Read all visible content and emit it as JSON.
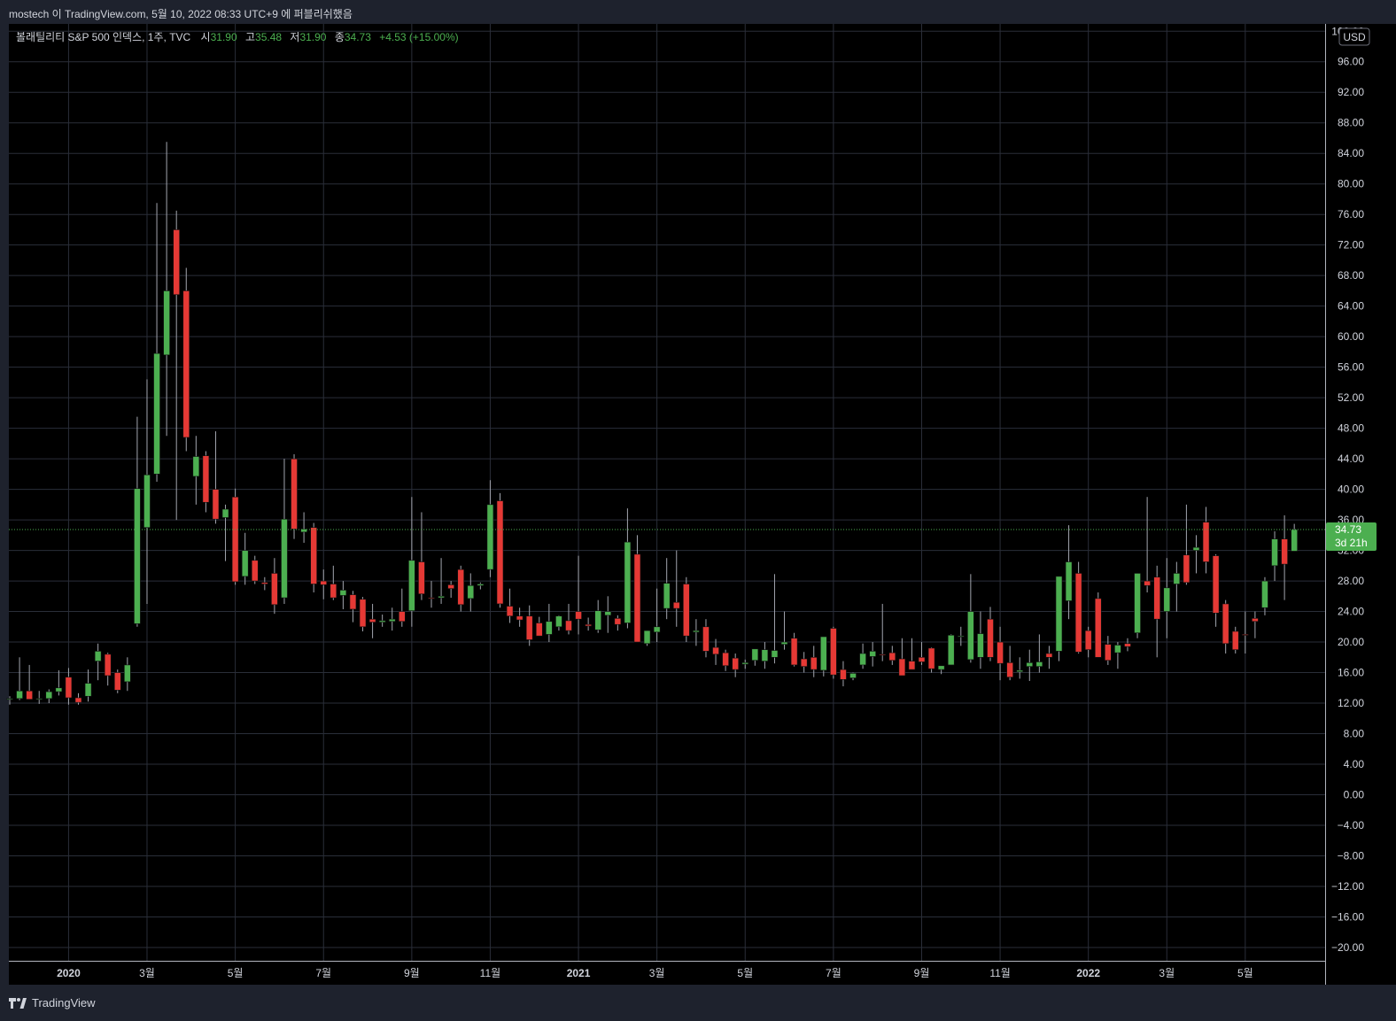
{
  "attribution": "mostech 이 TradingView.com, 5월 10, 2022 08:33 UTC+9 에 퍼블리쉬했음",
  "brand": "TradingView",
  "currency": "USD",
  "colors": {
    "up": "#4caf50",
    "down": "#e53935",
    "background": "#000000",
    "grid": "#2a2e39",
    "text": "#d1d4dc",
    "price_line": "#4caf50"
  },
  "legend": {
    "symbol": "볼래틸리티 S&P 500 인덱스, 1주, TVC",
    "o_label": "시",
    "o_value": "31.90",
    "h_label": "고",
    "h_value": "35.48",
    "l_label": "저",
    "l_value": "31.90",
    "c_label": "종",
    "c_value": "34.73",
    "change": "+4.53 (+15.00%)"
  },
  "last_price": {
    "value": "34.73",
    "countdown": "3d 21h"
  },
  "chart_data": {
    "type": "candlestick",
    "interval": "1주",
    "ylim": [
      -22,
      100
    ],
    "y_ticks": [
      -20,
      -16,
      -12,
      -8,
      -4,
      0,
      4,
      8,
      12,
      16,
      20,
      24,
      28,
      32,
      36,
      40,
      44,
      48,
      52,
      56,
      60,
      64,
      68,
      72,
      76,
      80,
      84,
      88,
      92,
      96,
      100
    ],
    "y_tick_labels": [
      "−20.00",
      "−16.00",
      "−12.00",
      "−8.00",
      "−4.00",
      "0.00",
      "4.00",
      "8.00",
      "12.00",
      "16.00",
      "20.00",
      "24.00",
      "28.00",
      "32.00",
      "36.00",
      "40.00",
      "44.00",
      "48.00",
      "52.00",
      "56.00",
      "60.00",
      "64.00",
      "68.00",
      "72.00",
      "76.00",
      "80.00",
      "84.00",
      "88.00",
      "92.00",
      "96.00",
      "100.00"
    ],
    "x_ticks": [
      {
        "label": "2020",
        "bold": true,
        "index": 6
      },
      {
        "label": "3월",
        "bold": false,
        "index": 14
      },
      {
        "label": "5월",
        "bold": false,
        "index": 23
      },
      {
        "label": "7월",
        "bold": false,
        "index": 32
      },
      {
        "label": "9월",
        "bold": false,
        "index": 41
      },
      {
        "label": "11월",
        "bold": false,
        "index": 49
      },
      {
        "label": "2021",
        "bold": true,
        "index": 58
      },
      {
        "label": "3월",
        "bold": false,
        "index": 66
      },
      {
        "label": "5월",
        "bold": false,
        "index": 75
      },
      {
        "label": "7월",
        "bold": false,
        "index": 84
      },
      {
        "label": "9월",
        "bold": false,
        "index": 93
      },
      {
        "label": "11월",
        "bold": false,
        "index": 101
      },
      {
        "label": "2022",
        "bold": true,
        "index": 110
      },
      {
        "label": "3월",
        "bold": false,
        "index": 118
      },
      {
        "label": "5월",
        "bold": false,
        "index": 126
      }
    ],
    "ohlc": [
      [
        12.5,
        12.9,
        11.8,
        12.6
      ],
      [
        12.6,
        18.0,
        12.4,
        13.6
      ],
      [
        13.6,
        17.0,
        12.5,
        12.5
      ],
      [
        12.5,
        13.6,
        11.9,
        12.6
      ],
      [
        12.6,
        13.8,
        12.0,
        13.5
      ],
      [
        13.5,
        16.3,
        13.0,
        14.0
      ],
      [
        15.4,
        16.6,
        11.8,
        12.7
      ],
      [
        12.7,
        13.3,
        11.8,
        12.1
      ],
      [
        12.9,
        16.4,
        12.2,
        14.6
      ],
      [
        17.5,
        19.8,
        15.0,
        18.8
      ],
      [
        18.4,
        18.6,
        14.3,
        15.6
      ],
      [
        16.0,
        16.4,
        13.3,
        13.7
      ],
      [
        14.8,
        18.0,
        13.6,
        17.0
      ],
      [
        22.4,
        49.5,
        22.0,
        40.1
      ],
      [
        35.0,
        54.4,
        25.0,
        41.9
      ],
      [
        42.0,
        77.5,
        41.0,
        57.8
      ],
      [
        57.6,
        85.5,
        47.0,
        66.0
      ],
      [
        74.0,
        76.5,
        36.0,
        65.5
      ],
      [
        66.0,
        69.0,
        45.0,
        46.8
      ],
      [
        41.7,
        47.0,
        38.0,
        44.3
      ],
      [
        44.4,
        45.0,
        37.0,
        38.3
      ],
      [
        40.0,
        47.6,
        35.5,
        36.1
      ],
      [
        36.3,
        38.0,
        30.6,
        37.4
      ],
      [
        39.0,
        40.1,
        27.5,
        27.9
      ],
      [
        28.6,
        34.3,
        27.5,
        32.0
      ],
      [
        30.7,
        31.3,
        27.6,
        28.0
      ],
      [
        27.8,
        28.5,
        26.8,
        27.6
      ],
      [
        29.0,
        31.0,
        23.7,
        24.9
      ],
      [
        25.8,
        44.0,
        25.0,
        36.1
      ],
      [
        44.0,
        44.6,
        33.5,
        34.8
      ],
      [
        34.4,
        37.0,
        33.0,
        34.8
      ],
      [
        35.0,
        35.6,
        26.5,
        27.6
      ],
      [
        28.0,
        29.5,
        25.6,
        27.5
      ],
      [
        27.6,
        30.0,
        25.5,
        25.8
      ],
      [
        26.1,
        28.0,
        24.3,
        26.8
      ],
      [
        26.2,
        26.7,
        22.6,
        24.3
      ],
      [
        25.6,
        25.9,
        21.4,
        22.0
      ],
      [
        23.0,
        25.0,
        20.5,
        22.6
      ],
      [
        22.6,
        23.6,
        22.0,
        22.8
      ],
      [
        22.7,
        24.5,
        21.5,
        23.0
      ],
      [
        24.0,
        27.0,
        22.0,
        22.7
      ],
      [
        24.1,
        39.0,
        22.0,
        30.7
      ],
      [
        30.5,
        37.0,
        25.5,
        26.3
      ],
      [
        25.8,
        28.0,
        24.5,
        25.7
      ],
      [
        25.8,
        31.0,
        25.0,
        26.0
      ],
      [
        27.5,
        28.0,
        25.8,
        27.0
      ],
      [
        29.5,
        30.0,
        24.0,
        24.9
      ],
      [
        25.7,
        29.0,
        24.0,
        27.4
      ],
      [
        27.4,
        27.8,
        26.9,
        27.6
      ],
      [
        29.5,
        41.2,
        28.5,
        38.0
      ],
      [
        38.5,
        39.5,
        24.5,
        25.0
      ],
      [
        24.7,
        27.0,
        22.5,
        23.4
      ],
      [
        23.4,
        24.5,
        22.0,
        22.9
      ],
      [
        23.4,
        24.8,
        19.5,
        20.3
      ],
      [
        22.5,
        23.3,
        20.8,
        20.8
      ],
      [
        21.0,
        25.0,
        20.0,
        22.7
      ],
      [
        22.0,
        23.5,
        21.5,
        23.4
      ],
      [
        22.8,
        25.0,
        21.0,
        21.5
      ],
      [
        24.0,
        31.3,
        21.0,
        23.0
      ],
      [
        22.3,
        23.2,
        21.5,
        22.1
      ],
      [
        21.6,
        25.5,
        21.2,
        24.1
      ],
      [
        23.5,
        26.0,
        21.2,
        24.0
      ],
      [
        23.1,
        23.5,
        21.5,
        22.3
      ],
      [
        22.5,
        37.5,
        21.8,
        33.1
      ],
      [
        31.5,
        34.0,
        20.5,
        20.0
      ],
      [
        19.8,
        21.5,
        19.5,
        21.5
      ],
      [
        21.3,
        27.0,
        20.0,
        22.0
      ],
      [
        24.4,
        31.0,
        23.0,
        27.7
      ],
      [
        25.2,
        32.0,
        22.0,
        24.4
      ],
      [
        27.6,
        28.5,
        20.0,
        20.8
      ],
      [
        21.3,
        23.0,
        19.5,
        21.5
      ],
      [
        22.0,
        23.0,
        18.0,
        18.8
      ],
      [
        19.3,
        20.4,
        17.0,
        18.4
      ],
      [
        18.6,
        19.0,
        16.2,
        16.9
      ],
      [
        17.9,
        18.5,
        15.4,
        16.4
      ],
      [
        17.1,
        17.7,
        16.5,
        17.3
      ],
      [
        17.6,
        19.0,
        16.9,
        19.1
      ],
      [
        17.5,
        20.0,
        16.5,
        19.0
      ],
      [
        18.0,
        28.9,
        17.2,
        18.9
      ],
      [
        19.7,
        24.0,
        19.0,
        20.0
      ],
      [
        20.5,
        21.2,
        16.8,
        17.0
      ],
      [
        17.8,
        18.7,
        16.0,
        16.8
      ],
      [
        18.0,
        19.5,
        15.4,
        16.4
      ],
      [
        16.3,
        19.0,
        15.5,
        20.7
      ],
      [
        21.8,
        22.0,
        15.2,
        15.7
      ],
      [
        16.4,
        17.5,
        14.2,
        15.1
      ],
      [
        15.3,
        16.0,
        15.0,
        15.9
      ],
      [
        17.0,
        19.8,
        16.5,
        18.5
      ],
      [
        18.1,
        20.0,
        16.8,
        18.8
      ],
      [
        18.4,
        25.0,
        17.5,
        18.3
      ],
      [
        18.6,
        19.5,
        17.0,
        17.6
      ],
      [
        17.8,
        20.5,
        16.5,
        15.6
      ],
      [
        17.5,
        20.5,
        16.9,
        16.4
      ],
      [
        18.0,
        20.0,
        17.0,
        17.4
      ],
      [
        19.2,
        19.3,
        16.0,
        16.5
      ],
      [
        16.4,
        16.8,
        15.8,
        16.9
      ],
      [
        17.0,
        21.0,
        17.0,
        20.9
      ],
      [
        20.7,
        22.0,
        19.5,
        20.8
      ],
      [
        17.7,
        28.9,
        17.3,
        24.0
      ],
      [
        18.0,
        24.0,
        16.5,
        21.1
      ],
      [
        23.0,
        24.6,
        17.5,
        18.0
      ],
      [
        20.0,
        22.0,
        15.0,
        17.2
      ],
      [
        17.3,
        19.5,
        15.0,
        15.4
      ],
      [
        16.1,
        18.0,
        15.2,
        16.3
      ],
      [
        16.8,
        19.0,
        14.9,
        17.3
      ],
      [
        16.8,
        21.0,
        16.0,
        17.4
      ],
      [
        18.5,
        19.5,
        16.5,
        18.0
      ],
      [
        18.8,
        27.0,
        17.5,
        28.6
      ],
      [
        25.4,
        35.3,
        23.0,
        30.5
      ],
      [
        29.0,
        30.5,
        18.5,
        18.7
      ],
      [
        21.5,
        22.0,
        18.0,
        19.0
      ],
      [
        25.7,
        26.5,
        18.5,
        18.0
      ],
      [
        19.7,
        20.8,
        17.0,
        17.6
      ],
      [
        18.6,
        20.0,
        16.5,
        19.6
      ],
      [
        19.8,
        20.5,
        18.8,
        19.4
      ],
      [
        21.2,
        29.0,
        20.5,
        29.0
      ],
      [
        28.0,
        39.0,
        26.5,
        27.4
      ],
      [
        28.5,
        30.0,
        18.0,
        23.0
      ],
      [
        24.0,
        31.0,
        20.5,
        27.1
      ],
      [
        27.6,
        30.5,
        24.0,
        29.0
      ],
      [
        31.4,
        38.0,
        27.5,
        27.8
      ],
      [
        32.0,
        34.0,
        29.0,
        32.4
      ],
      [
        35.7,
        37.7,
        29.0,
        30.5
      ],
      [
        31.3,
        31.5,
        22.0,
        23.8
      ],
      [
        25.0,
        25.5,
        18.5,
        19.8
      ],
      [
        21.4,
        22.0,
        18.5,
        19.0
      ],
      [
        21.0,
        24.0,
        18.5,
        20.9
      ],
      [
        23.1,
        24.0,
        20.5,
        22.7
      ],
      [
        24.5,
        28.5,
        23.5,
        28.0
      ],
      [
        30.0,
        34.5,
        28.0,
        33.5
      ],
      [
        33.5,
        36.6,
        25.5,
        30.2
      ],
      [
        31.9,
        35.48,
        31.9,
        34.73
      ]
    ]
  }
}
